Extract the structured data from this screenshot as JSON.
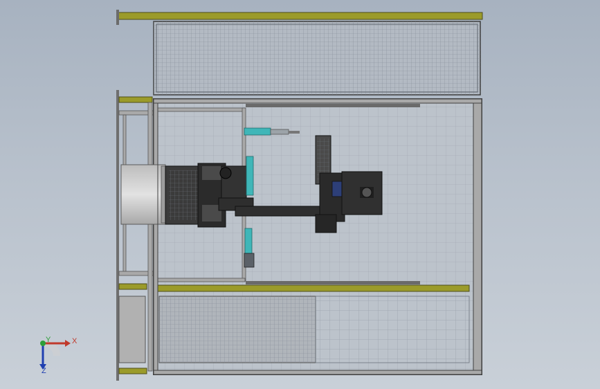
{
  "viewport": {
    "background_top": "#a7b2c0",
    "background_bottom": "#c9d0d8"
  },
  "colors": {
    "frame_olive": "#9b9b2a",
    "frame_gray": "#a9a9a9",
    "mesh_line": "#7f8792",
    "robot_dark": "#2b2b2b",
    "robot_mid": "#4a4a4a",
    "tool_cyan": "#3fb6b8",
    "cylinder_light": "#d6d6d6",
    "triad_x": "#c0392b",
    "triad_y": "#2e9e3a",
    "triad_z": "#1f3fb0"
  },
  "triad": {
    "x_label": "X",
    "y_label": "Y",
    "z_label": "Z"
  }
}
